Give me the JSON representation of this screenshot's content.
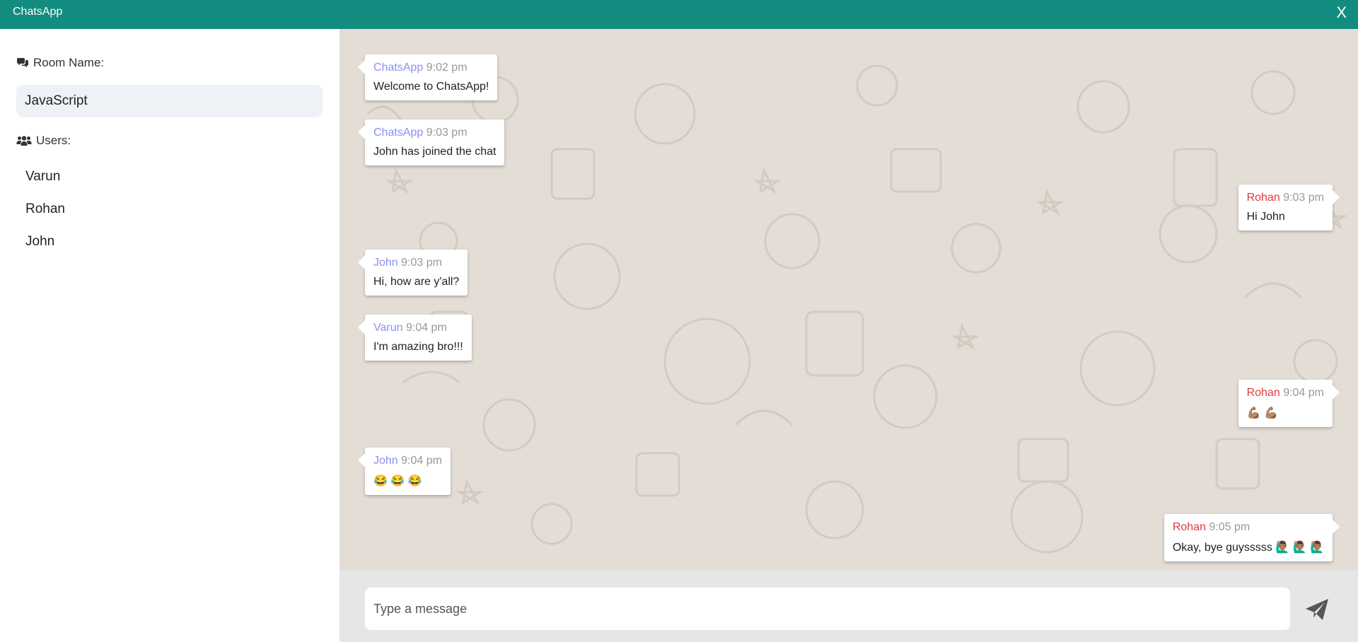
{
  "app": {
    "title": "ChatsApp",
    "close_label": "X"
  },
  "sidebar": {
    "room_label": "Room Name:",
    "room_name": "JavaScript",
    "users_label": "Users:",
    "users": [
      "Varun",
      "Rohan",
      "John"
    ]
  },
  "messages": [
    {
      "sender": "ChatsApp",
      "time": "9:02 pm",
      "text": "Welcome to ChatsApp!",
      "side": "left"
    },
    {
      "sender": "ChatsApp",
      "time": "9:03 pm",
      "text": "John has joined the chat",
      "side": "left"
    },
    {
      "sender": "Rohan",
      "time": "9:03 pm",
      "text": "Hi John",
      "side": "right"
    },
    {
      "sender": "John",
      "time": "9:03 pm",
      "text": "Hi, how are y'all?",
      "side": "left"
    },
    {
      "sender": "Varun",
      "time": "9:04 pm",
      "text": "I'm amazing bro!!!",
      "side": "left"
    },
    {
      "sender": "Rohan",
      "time": "9:04 pm",
      "text": "💪🏽 💪🏽",
      "side": "right"
    },
    {
      "sender": "John",
      "time": "9:04 pm",
      "text": "😂 😂 😂",
      "side": "left"
    },
    {
      "sender": "Rohan",
      "time": "9:05 pm",
      "text": "Okay, bye guysssss 🙋🏽‍♂️ 🙋🏽‍♂️ 🙋🏽‍♂️",
      "side": "right"
    }
  ],
  "composer": {
    "placeholder": "Type a message"
  },
  "colors": {
    "topbar": "#128c7e",
    "chat_background": "#e4ddd6",
    "sender_left": "#8c8ff0",
    "sender_right": "#e0393e"
  },
  "icons": {
    "room": "comments-icon",
    "users": "users-icon",
    "send": "paper-plane-icon"
  }
}
